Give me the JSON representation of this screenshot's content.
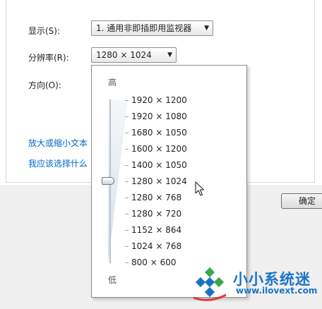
{
  "display": {
    "label": "显示(S):",
    "selected": "1. 通用非即插即用监视器",
    "arrow_icon": "chevron-down-icon"
  },
  "resolution": {
    "label": "分辨率(R):",
    "selected": "1280 × 1024",
    "arrow_icon": "chevron-down-icon",
    "dropdown": {
      "high_label": "高",
      "low_label": "低",
      "options": [
        "1920 × 1200",
        "1920 × 1080",
        "1680 × 1050",
        "1600 × 1200",
        "1400 × 1050",
        "1280 × 1024",
        "1280 × 768",
        "1280 × 720",
        "1152 × 864",
        "1024 × 768",
        "800 × 600"
      ],
      "selected_index": 5
    }
  },
  "orientation": {
    "label": "方向(O):"
  },
  "links": {
    "text_size": "放大或缩小文本",
    "which_settings": "我应该选择什么"
  },
  "buttons": {
    "ok": "确定"
  },
  "watermark": {
    "title": "小小系统迷",
    "url": "www.ilovext.com",
    "accent": "#1a74c6",
    "logo_accent": "#3aa64a"
  }
}
